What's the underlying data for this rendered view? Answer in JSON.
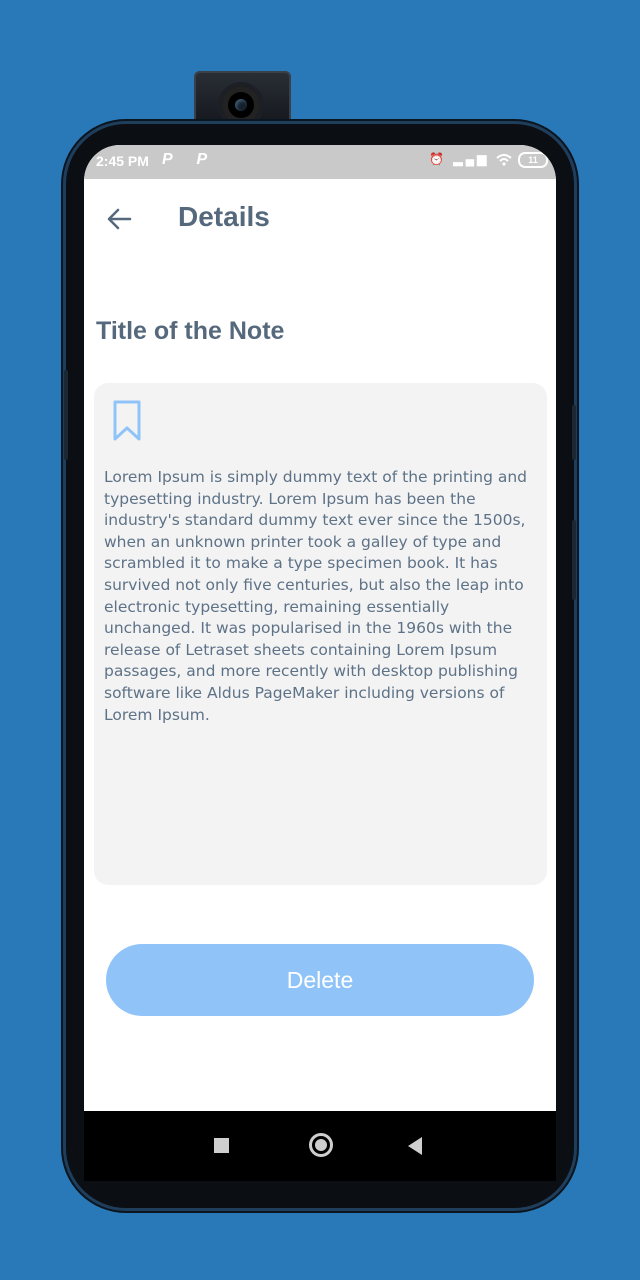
{
  "status_bar": {
    "time": "2:45 PM",
    "notification_icons": "P P",
    "battery_level": "11",
    "icons": [
      "alarm-icon",
      "volte-icon",
      "signal-icon",
      "wifi-icon",
      "battery-icon"
    ]
  },
  "app_bar": {
    "title": "Details",
    "back_icon": "arrow-left-icon"
  },
  "note": {
    "title": "Title of the Note",
    "bookmark_icon": "bookmark-icon",
    "body": "Lorem Ipsum is simply dummy text of the printing and typesetting industry. Lorem Ipsum has been the industry's standard dummy text ever since the 1500s, when an unknown printer took a galley of type and scrambled it to make a type specimen book. It has survived not only five centuries, but also the leap into electronic typesetting, remaining essentially unchanged. It was popularised in the 1960s with the release of Letraset sheets containing Lorem Ipsum passages, and more recently with desktop publishing software like Aldus PageMaker including versions of Lorem Ipsum."
  },
  "actions": {
    "delete_label": "Delete"
  },
  "colors": {
    "background": "#2979b9",
    "title_text": "#56697c",
    "body_text": "#5e7287",
    "card_background": "#f3f3f3",
    "delete_button": "#90c4f9",
    "bookmark": "#90c4f9"
  }
}
